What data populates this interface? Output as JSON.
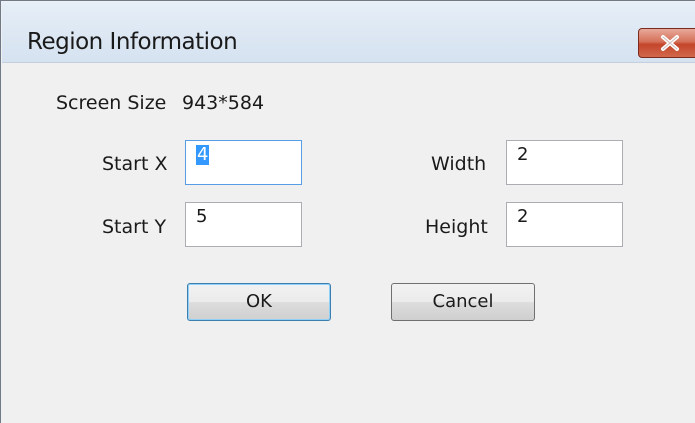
{
  "window": {
    "title": "Region Information"
  },
  "screen_size": {
    "label": "Screen Size",
    "value": "943*584"
  },
  "fields": {
    "start_x": {
      "label": "Start X",
      "value": "4"
    },
    "start_y": {
      "label": "Start Y",
      "value": "5"
    },
    "width": {
      "label": "Width",
      "value": "2"
    },
    "height": {
      "label": "Height",
      "value": "2"
    }
  },
  "buttons": {
    "ok": "OK",
    "cancel": "Cancel"
  },
  "icons": {
    "close": "close-icon"
  },
  "colors": {
    "title_bar": "#d9e5f2",
    "close_button": "#c94a30",
    "selection": "#3399ff",
    "focus_border": "#569de5"
  }
}
